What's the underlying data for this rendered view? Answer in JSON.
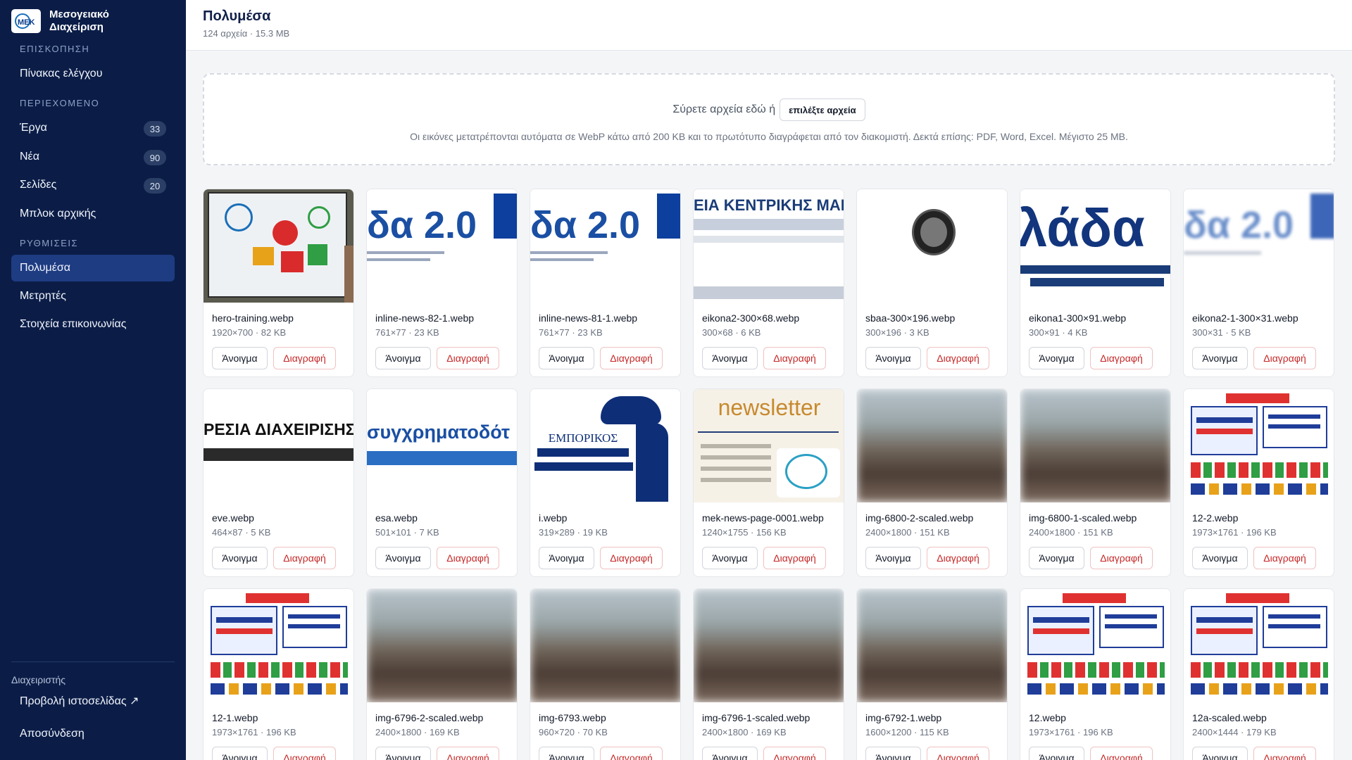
{
  "brand": {
    "name_line1": "Μεσογειακό",
    "name_line2": "Διαχείριση",
    "logo_text": "ΜΕΚ"
  },
  "sidebar": {
    "sections": [
      {
        "label": "ΕΠΙΣΚΟΠΗΣΗ"
      },
      {
        "label": "ΠΕΡΙΕΧΟΜΕΝΟ"
      },
      {
        "label": "ΡΥΘΜΙΣΕΙΣ"
      }
    ],
    "items": [
      {
        "label": "Πίνακας ελέγχου"
      },
      {
        "label": "Έργα",
        "badge": "33"
      },
      {
        "label": "Νέα",
        "badge": "90"
      },
      {
        "label": "Σελίδες",
        "badge": "20"
      },
      {
        "label": "Μπλοκ αρχικής"
      },
      {
        "label": "Πολυμέσα",
        "active": true
      },
      {
        "label": "Μετρητές"
      },
      {
        "label": "Στοιχεία επικοινωνίας"
      }
    ],
    "admin_label": "Διαχειριστής",
    "view_site": "Προβολή ιστοσελίδας ↗",
    "logout": "Αποσύνδεση"
  },
  "header": {
    "title": "Πολυμέσα",
    "subtitle": "124 αρχεία · 15.3 MB"
  },
  "dropzone": {
    "text": "Σύρετε αρχεία εδώ ή",
    "button": "επιλέξτε αρχεία",
    "hint": "Οι εικόνες μετατρέπονται αυτόματα σε WebP κάτω από 200 KB και το πρωτότυπο διαγράφεται από τον διακομιστή. Δεκτά επίσης: PDF, Word, Excel. Μέγιστο 25 MB."
  },
  "actions": {
    "open": "Άνοιγμα",
    "delete": "Διαγραφή"
  },
  "files": [
    {
      "name": "hero-training.webp",
      "meta": "1920×700 · 82 KB",
      "thumb": "hero",
      "thumb_text": ""
    },
    {
      "name": "inline-news-82-1.webp",
      "meta": "761×77 · 23 KB",
      "thumb": "greece20",
      "thumb_text": "δα 2.0"
    },
    {
      "name": "inline-news-81-1.webp",
      "meta": "761×77 · 23 KB",
      "thumb": "greece20",
      "thumb_text": "δα 2.0"
    },
    {
      "name": "eikona2-300×68.webp",
      "meta": "300×68 · 6 KB",
      "thumb": "kentriki",
      "thumb_text": "ΕΙΑ ΚΕΝΤΡΙΚΗΣ ΜΑΚΕΔ"
    },
    {
      "name": "sbaa-300×196.webp",
      "meta": "300×196 · 3 KB",
      "thumb": "coin",
      "thumb_text": ""
    },
    {
      "name": "eikona1-300×91.webp",
      "meta": "300×91 · 4 KB",
      "thumb": "ellada",
      "thumb_text": "λάδα"
    },
    {
      "name": "eikona2-1-300×31.webp",
      "meta": "300×31 · 5 KB",
      "thumb": "greece20blur",
      "thumb_text": "δα 2.0"
    },
    {
      "name": "eve.webp",
      "meta": "464×87 · 5 KB",
      "thumb": "eve",
      "thumb_text": "ΡΕΣΙΑ ΔΙΑΧΕΙΡΙΣΗΣ"
    },
    {
      "name": "esa.webp",
      "meta": "501×101 · 7 KB",
      "thumb": "esa",
      "thumb_text": "συγχρηματοδότ"
    },
    {
      "name": "i.webp",
      "meta": "319×289 · 19 KB",
      "thumb": "emporikos",
      "thumb_text": "ΕΜΠΟΡΙΚΟΣ"
    },
    {
      "name": "mek-news-page-0001.webp",
      "meta": "1240×1755 · 156 KB",
      "thumb": "newsletter",
      "thumb_text": "newsletter"
    },
    {
      "name": "img-6800-2-scaled.webp",
      "meta": "2400×1800 · 151 KB",
      "thumb": "photo",
      "thumb_text": ""
    },
    {
      "name": "img-6800-1-scaled.webp",
      "meta": "2400×1800 · 151 KB",
      "thumb": "photo",
      "thumb_text": ""
    },
    {
      "name": "12-2.webp",
      "meta": "1973×1761 · 196 KB",
      "thumb": "poster",
      "thumb_text": ""
    },
    {
      "name": "12-1.webp",
      "meta": "1973×1761 · 196 KB",
      "thumb": "poster",
      "thumb_text": ""
    },
    {
      "name": "img-6796-2-scaled.webp",
      "meta": "2400×1800 · 169 KB",
      "thumb": "photo",
      "thumb_text": ""
    },
    {
      "name": "img-6793.webp",
      "meta": "960×720 · 70 KB",
      "thumb": "photo",
      "thumb_text": ""
    },
    {
      "name": "img-6796-1-scaled.webp",
      "meta": "2400×1800 · 169 KB",
      "thumb": "photo",
      "thumb_text": ""
    },
    {
      "name": "img-6792-1.webp",
      "meta": "1600×1200 · 115 KB",
      "thumb": "photo",
      "thumb_text": ""
    },
    {
      "name": "12.webp",
      "meta": "1973×1761 · 196 KB",
      "thumb": "poster",
      "thumb_text": ""
    },
    {
      "name": "12a-scaled.webp",
      "meta": "2400×1444 · 179 KB",
      "thumb": "poster",
      "thumb_text": ""
    }
  ],
  "colors": {
    "sidebar_bg": "#0b1d47",
    "active_bg": "#1e3c82",
    "delete_red": "#c62828",
    "accent_blue": "#1a4fa3"
  }
}
